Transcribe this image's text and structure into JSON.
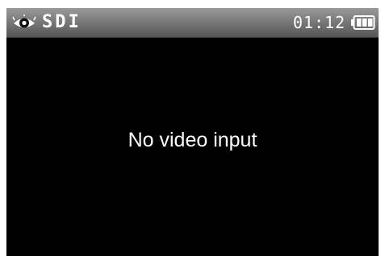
{
  "status_bar": {
    "icon": "eye-icon",
    "mode": "SDI",
    "time": "01:12",
    "battery_icon": "battery-icon",
    "battery_level": 0.9
  },
  "main": {
    "message": "No video input"
  },
  "colors": {
    "screen_background": "#000000",
    "status_bar_top": "#9a9a9a",
    "status_bar_bottom": "#555555",
    "text": "#ffffff"
  }
}
